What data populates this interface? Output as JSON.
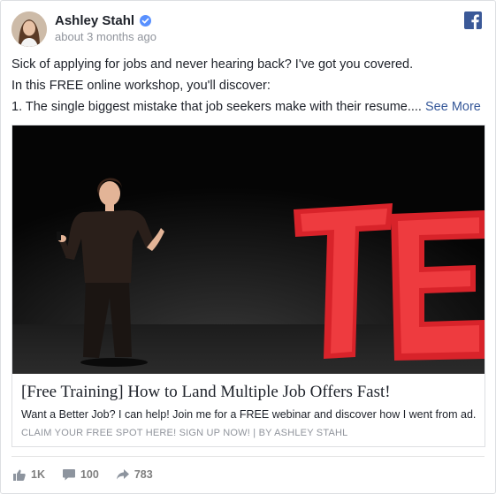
{
  "post": {
    "author": "Ashley Stahl",
    "timestamp": "about 3 months ago",
    "text_lines": [
      "Sick of applying for jobs and never hearing back? I've got you covered.",
      "In this FREE online workshop, you'll discover:",
      "1. The single biggest mistake that job seekers make with their resume...."
    ],
    "see_more": "See More"
  },
  "link": {
    "title": "[Free Training] How to Land Multiple Job Offers Fast!",
    "description": "Want a Better Job? I can help! Join me for a FREE webinar and discover how I went from ad...",
    "caption": "CLAIM YOUR FREE SPOT HERE! SIGN UP NOW!",
    "byline": "BY ASHLEY STAHL",
    "separator": "|"
  },
  "stats": {
    "likes": "1K",
    "comments": "100",
    "shares": "783"
  },
  "icons": {
    "verified": "verified-badge-icon",
    "facebook": "facebook-logo-icon",
    "like": "thumbs-up-icon",
    "comment": "comment-icon",
    "share": "share-arrow-icon"
  },
  "colors": {
    "link": "#365899",
    "verified": "#5890ff",
    "facebook": "#3b5998",
    "muted": "#90949c"
  }
}
